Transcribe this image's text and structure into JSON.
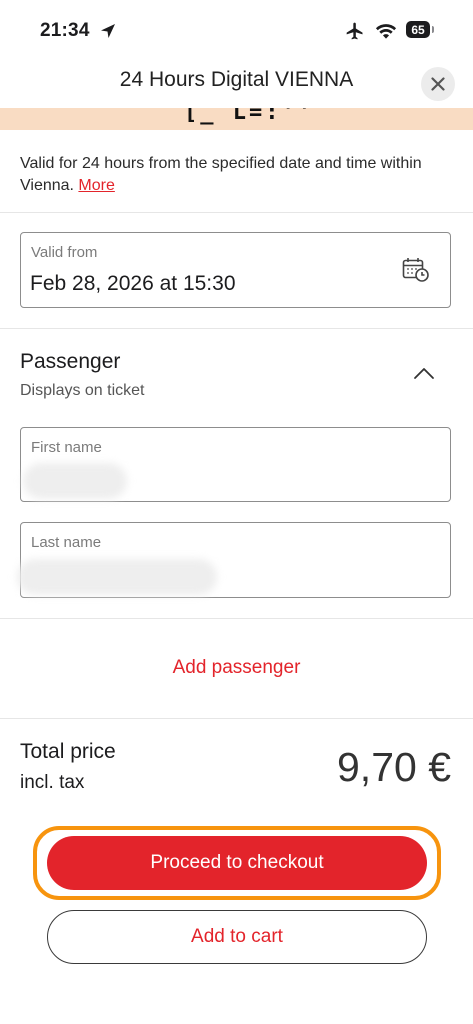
{
  "status_bar": {
    "time": "21:34",
    "battery": "65"
  },
  "header": {
    "title": "24 Hours Digital VIENNA"
  },
  "banner": {
    "code": "[_ L=:''"
  },
  "description": {
    "text": "Valid for 24 hours from the specified date and time within Vienna. ",
    "more_link": "More"
  },
  "valid_from": {
    "label": "Valid from",
    "value": "Feb 28, 2026 at 15:30"
  },
  "passenger": {
    "title": "Passenger",
    "subtitle": "Displays on ticket",
    "first_name_label": "First name",
    "first_name_value": "",
    "last_name_label": "Last name",
    "last_name_value": ""
  },
  "add_passenger": "Add passenger",
  "total": {
    "label": "Total price",
    "tax_note": "incl. tax",
    "price": "9,70 €"
  },
  "actions": {
    "checkout": "Proceed to checkout",
    "add_to_cart": "Add to cart"
  },
  "colors": {
    "accent": "#e3242b",
    "focus": "#f7940e",
    "banner": "#f9dcc3"
  }
}
